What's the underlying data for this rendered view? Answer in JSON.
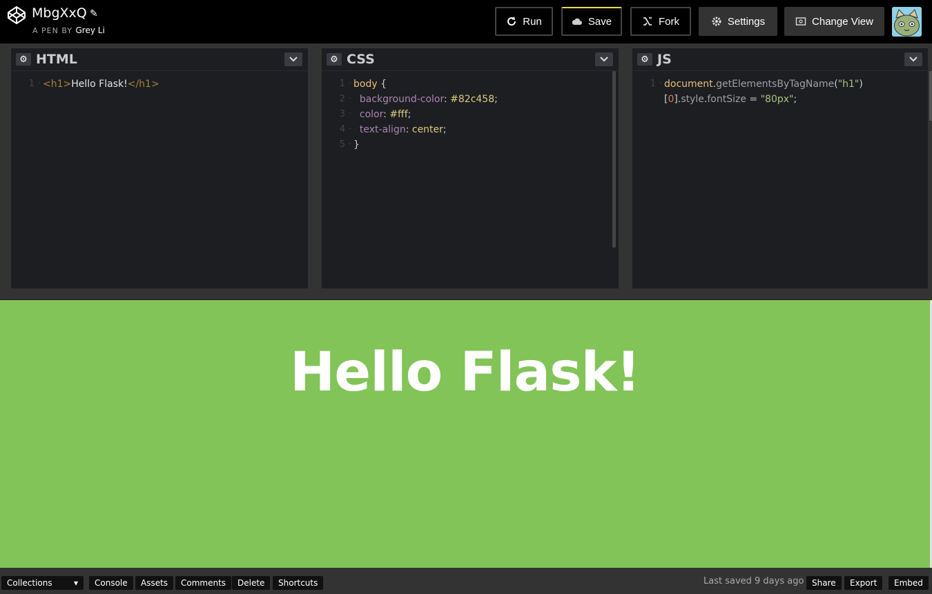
{
  "header": {
    "title": "MbgXxQ",
    "byline_prefix": "A PEN BY",
    "author": "Grey Li",
    "buttons": {
      "run": "Run",
      "save": "Save",
      "fork": "Fork",
      "settings": "Settings",
      "change_view": "Change View"
    },
    "icons": {
      "logo": "codepen-logo-icon",
      "pencil": "pencil-icon",
      "run": "refresh-icon",
      "save": "cloud-icon",
      "fork": "fork-icon",
      "settings": "gear-icon",
      "change_view": "window-icon"
    },
    "accent": "#ffdd40"
  },
  "editors": {
    "html": {
      "title": "HTML",
      "lines": [
        {
          "num": "1",
          "parts": [
            [
              "tag",
              "<h1>"
            ],
            [
              "txt",
              "Hello Flask!"
            ],
            [
              "tag",
              "</h1>"
            ]
          ]
        }
      ]
    },
    "css": {
      "title": "CSS",
      "lines": [
        {
          "num": "1",
          "parts": [
            [
              "sel",
              "body"
            ],
            [
              "punc",
              " {"
            ]
          ]
        },
        {
          "num": "2",
          "parts": [
            [
              "prop",
              "  background-color"
            ],
            [
              "punc",
              ": "
            ],
            [
              "val",
              "#82c458"
            ],
            [
              "punc",
              ";"
            ]
          ]
        },
        {
          "num": "3",
          "parts": [
            [
              "prop",
              "  color"
            ],
            [
              "punc",
              ": "
            ],
            [
              "val",
              "#fff"
            ],
            [
              "punc",
              ";"
            ]
          ]
        },
        {
          "num": "4",
          "parts": [
            [
              "prop",
              "  text-align"
            ],
            [
              "punc",
              ": "
            ],
            [
              "val",
              "center"
            ],
            [
              "punc",
              ";"
            ]
          ]
        },
        {
          "num": "5",
          "parts": [
            [
              "punc",
              "}"
            ]
          ]
        }
      ]
    },
    "js": {
      "title": "JS",
      "lines": [
        {
          "num": "1",
          "parts": [
            [
              "obj",
              "document"
            ],
            [
              "punc",
              "."
            ],
            [
              "fn",
              "getElementsByTagName"
            ],
            [
              "punc",
              "("
            ],
            [
              "str",
              "\"h1\""
            ],
            [
              "punc",
              ")"
            ]
          ]
        },
        {
          "num": "",
          "parts": [
            [
              "punc",
              "["
            ],
            [
              "num",
              "0"
            ],
            [
              "punc",
              "]."
            ],
            [
              "fn",
              "style"
            ],
            [
              "punc",
              "."
            ],
            [
              "fn",
              "fontSize"
            ],
            [
              "punc",
              " = "
            ],
            [
              "str",
              "\"80px\""
            ],
            [
              "punc",
              ";"
            ]
          ]
        }
      ]
    }
  },
  "preview": {
    "heading": "Hello Flask!",
    "background": "#82c458",
    "color": "#fff"
  },
  "footer": {
    "collections": "Collections",
    "console": "Console",
    "assets": "Assets",
    "comments": "Comments",
    "delete": "Delete",
    "shortcuts": "Shortcuts",
    "last_saved": "Last saved 9 days ago",
    "share": "Share",
    "export": "Export",
    "embed": "Embed"
  }
}
